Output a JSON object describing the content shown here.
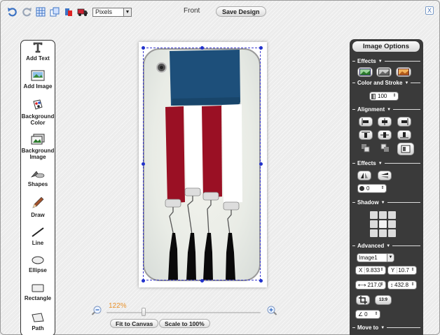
{
  "toolbar": {
    "unit_value": "Pixels"
  },
  "side_label": "Front",
  "save_button": "Save Design",
  "close_label": "X",
  "tools": [
    {
      "name": "add-text",
      "label": "Add Text",
      "icon": "text-icon"
    },
    {
      "name": "add-image",
      "label": "Add Image",
      "icon": "image-icon"
    },
    {
      "name": "background-color",
      "label": "Background Color",
      "icon": "palette-icon"
    },
    {
      "name": "background-image",
      "label": "Background Image",
      "icon": "background-image-icon"
    },
    {
      "name": "shapes",
      "label": "Shapes",
      "icon": "shapes-icon"
    },
    {
      "name": "draw",
      "label": "Draw",
      "icon": "pencil-icon"
    },
    {
      "name": "line",
      "label": "Line",
      "icon": "line-icon"
    },
    {
      "name": "ellipse",
      "label": "Ellipse",
      "icon": "ellipse-icon"
    },
    {
      "name": "rectangle",
      "label": "Rectangle",
      "icon": "rectangle-icon"
    },
    {
      "name": "path",
      "label": "Path",
      "icon": "path-icon"
    }
  ],
  "zoom": {
    "label": "122%",
    "level_fraction": 0.24
  },
  "buttons": {
    "fit": "Fit to Canvas",
    "scale": "Scale to 100%"
  },
  "options": {
    "title": "Image Options",
    "sections": {
      "effects": "Effects",
      "color_stroke": "Color and Stroke",
      "alignment": "Alignment",
      "effects2": "Effects",
      "shadow": "Shadow",
      "advanced": "Advanced",
      "move_to": "Move to"
    },
    "opacity_value": "100",
    "rotate_value": "0",
    "layer_value": "Image1",
    "x_label": "X",
    "x_value": "9.833",
    "y_label": "Y",
    "y_value": "10.7",
    "w_value": "217.0",
    "h_value": "432.8",
    "ratio_label": "13:9",
    "angle_value": "0"
  },
  "colors": {
    "navy": "#1d4f7a",
    "red": "#9a1024",
    "accent_zoom": "#e8912a",
    "selection": "#3b3bd0"
  }
}
